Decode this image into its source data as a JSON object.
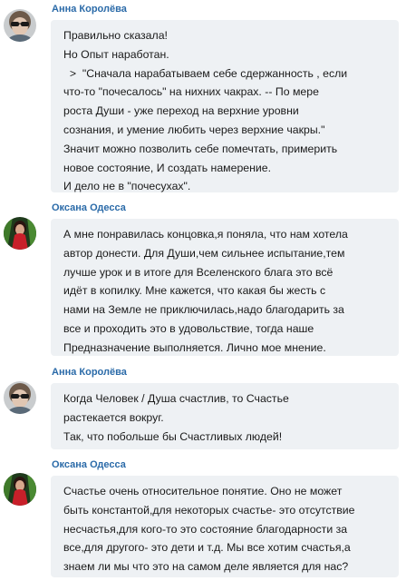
{
  "messages": [
    {
      "author": "Анна Королёва",
      "avatar_icon": "avatar-anna",
      "lines": [
        "Правильно сказала!",
        "Но Опыт наработан.",
        "  >  \"Сначала нарабатываем себе сдержанность , если",
        "что-то \"почесалось\" на нихних чакрах. -- По мере",
        "роста Души - уже переход на верхние уровни",
        "сознания, и умение любить через верхние чакры.\"",
        "Значит можно позволить себе помечтать, примерить",
        "новое состояние, И создать намерение.",
        "И дело не в \"почесухах\"."
      ]
    },
    {
      "author": "Оксана Одесса",
      "avatar_icon": "avatar-oksana",
      "lines": [
        "А мне понравилась концовка,я поняла, что нам хотела",
        "автор донести. Для Души,чем сильнее испытание,тем",
        "лучше урок и в итоге для Вселенского блага это всё",
        "идёт в копилку. Мне кажется, что какая бы жесть с",
        "нами на Земле не приключилась,надо благодарить за",
        "все и проходить это в удовольствие, тогда наше",
        "Предназначение выполняется. Лично мое мнение."
      ]
    },
    {
      "author": "Анна Королёва",
      "avatar_icon": "avatar-anna",
      "lines": [
        "Когда Человек / Душа счастлив, то Счастье",
        "растекается вокруг.",
        "Так, что побольше бы Счастливых людей!"
      ]
    },
    {
      "author": "Оксана Одесса",
      "avatar_icon": "avatar-oksana",
      "lines": [
        "Счастье очень относительное понятие. Оно не может",
        "быть константой,для некоторых счастье- это отсутствие",
        "несчастья,для кого-то это состояние благодарности за",
        "все,для другого- это дети и т.д. Мы все хотим счастья,а",
        "знаем ли мы что это на самом деле является для нас?"
      ]
    }
  ]
}
